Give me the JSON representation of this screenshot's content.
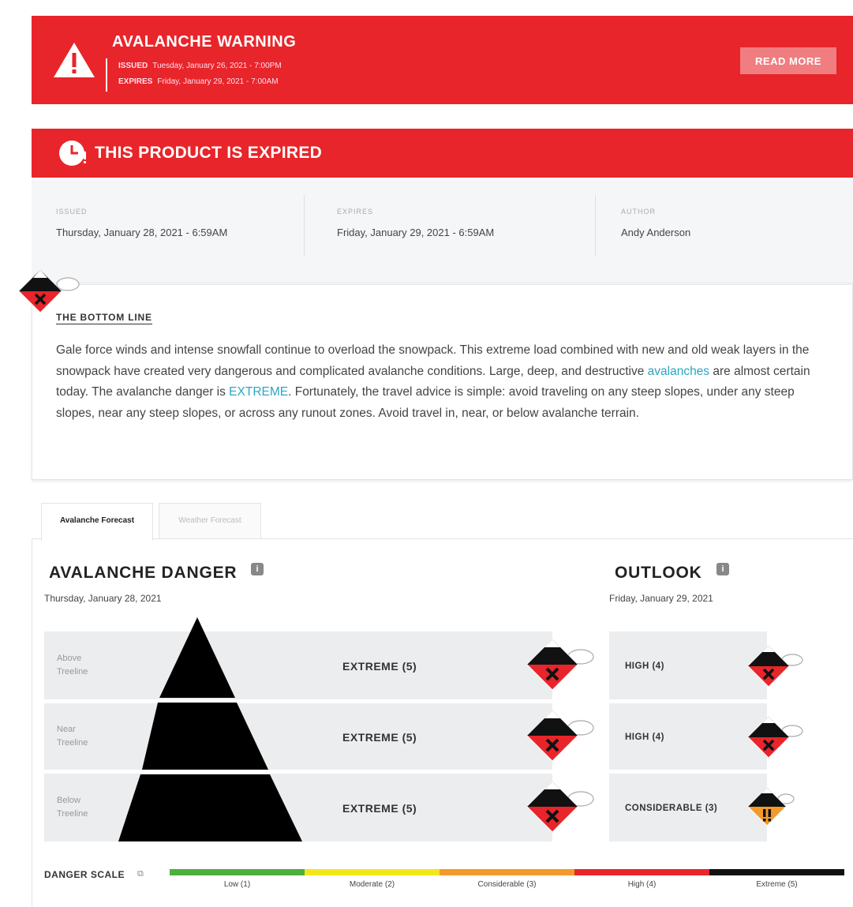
{
  "warning": {
    "title": "AVALANCHE WARNING",
    "issued_label": "ISSUED",
    "issued_value": "Tuesday, January 26, 2021 - 7:00PM",
    "expires_label": "EXPIRES",
    "expires_value": "Friday, January 29, 2021 - 7:00AM",
    "read_more": "READ MORE",
    "color": "#e8252a"
  },
  "expired": {
    "text": "THIS PRODUCT IS EXPIRED"
  },
  "meta": {
    "issued_label": "ISSUED",
    "issued_value": "Thursday, January 28, 2021 - 6:59AM",
    "expires_label": "EXPIRES",
    "expires_value": "Friday, January 29, 2021 - 6:59AM",
    "author_label": "AUTHOR",
    "author_value": "Andy Anderson"
  },
  "bottom_line": {
    "title": "THE BOTTOM LINE",
    "p1": "Gale force winds and intense snowfall continue to overload the snowpack. This extreme load combined with new and old weak layers in the snowpack have created very dangerous and complicated avalanche conditions. Large, deep, and destructive ",
    "link1": "avalanches",
    "p2": " are almost certain today.  The avalanche danger is ",
    "link2": "EXTREME",
    "p3": ".  Fortunately, the travel advice is simple: avoid traveling on any steep slopes, under any steep slopes, near any steep slopes, or across any runout zones. Avoid travel in, near, or below avalanche terrain."
  },
  "tabs": {
    "active": "Avalanche Forecast",
    "inactive": "Weather Forecast"
  },
  "danger": {
    "title": "AVALANCHE DANGER",
    "date": "Thursday, January 28, 2021",
    "rows": [
      {
        "elevation_1": "Above",
        "elevation_2": "Treeline",
        "level": "EXTREME (5)"
      },
      {
        "elevation_1": "Near",
        "elevation_2": "Treeline",
        "level": "EXTREME (5)"
      },
      {
        "elevation_1": "Below",
        "elevation_2": "Treeline",
        "level": "EXTREME (5)"
      }
    ]
  },
  "outlook": {
    "title": "OUTLOOK",
    "date": "Friday, January 29, 2021",
    "rows": [
      {
        "level": "HIGH (4)"
      },
      {
        "level": "HIGH (4)"
      },
      {
        "level": "CONSIDERABLE (3)"
      }
    ]
  },
  "danger_scale": {
    "label": "DANGER SCALE",
    "levels": [
      {
        "name": "Low (1)",
        "color": "#4caf3e"
      },
      {
        "name": "Moderate (2)",
        "color": "#f4e61c"
      },
      {
        "name": "Considerable (3)",
        "color": "#f39a2b"
      },
      {
        "name": "High (4)",
        "color": "#e8252a"
      },
      {
        "name": "Extreme (5)",
        "color": "#111111"
      }
    ]
  },
  "icons": {
    "warning": "warning-triangle-icon",
    "expired": "clock-icon",
    "extreme": "extreme-danger-icon",
    "high": "high-danger-icon",
    "considerable": "considerable-danger-icon",
    "info": "info-icon",
    "external": "external-link-icon"
  }
}
